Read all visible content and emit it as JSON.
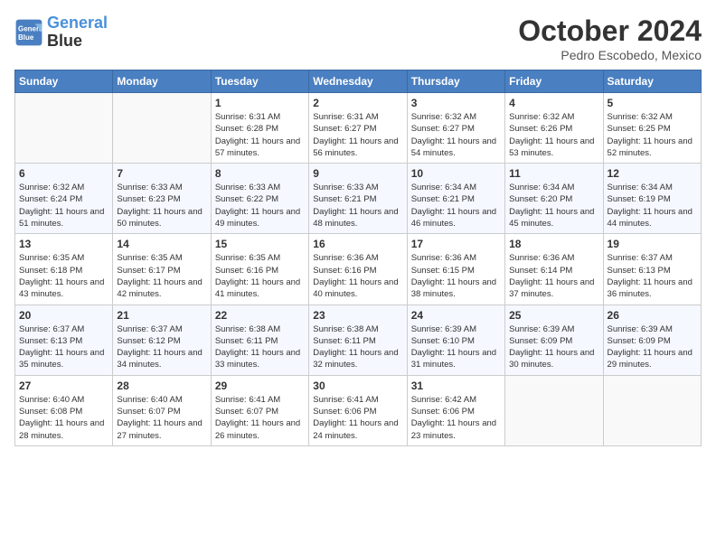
{
  "header": {
    "logo_line1": "General",
    "logo_line2": "Blue",
    "month_year": "October 2024",
    "location": "Pedro Escobedo, Mexico"
  },
  "weekdays": [
    "Sunday",
    "Monday",
    "Tuesday",
    "Wednesday",
    "Thursday",
    "Friday",
    "Saturday"
  ],
  "weeks": [
    [
      {
        "day": "",
        "info": ""
      },
      {
        "day": "",
        "info": ""
      },
      {
        "day": "1",
        "info": "Sunrise: 6:31 AM\nSunset: 6:28 PM\nDaylight: 11 hours and 57 minutes."
      },
      {
        "day": "2",
        "info": "Sunrise: 6:31 AM\nSunset: 6:27 PM\nDaylight: 11 hours and 56 minutes."
      },
      {
        "day": "3",
        "info": "Sunrise: 6:32 AM\nSunset: 6:27 PM\nDaylight: 11 hours and 54 minutes."
      },
      {
        "day": "4",
        "info": "Sunrise: 6:32 AM\nSunset: 6:26 PM\nDaylight: 11 hours and 53 minutes."
      },
      {
        "day": "5",
        "info": "Sunrise: 6:32 AM\nSunset: 6:25 PM\nDaylight: 11 hours and 52 minutes."
      }
    ],
    [
      {
        "day": "6",
        "info": "Sunrise: 6:32 AM\nSunset: 6:24 PM\nDaylight: 11 hours and 51 minutes."
      },
      {
        "day": "7",
        "info": "Sunrise: 6:33 AM\nSunset: 6:23 PM\nDaylight: 11 hours and 50 minutes."
      },
      {
        "day": "8",
        "info": "Sunrise: 6:33 AM\nSunset: 6:22 PM\nDaylight: 11 hours and 49 minutes."
      },
      {
        "day": "9",
        "info": "Sunrise: 6:33 AM\nSunset: 6:21 PM\nDaylight: 11 hours and 48 minutes."
      },
      {
        "day": "10",
        "info": "Sunrise: 6:34 AM\nSunset: 6:21 PM\nDaylight: 11 hours and 46 minutes."
      },
      {
        "day": "11",
        "info": "Sunrise: 6:34 AM\nSunset: 6:20 PM\nDaylight: 11 hours and 45 minutes."
      },
      {
        "day": "12",
        "info": "Sunrise: 6:34 AM\nSunset: 6:19 PM\nDaylight: 11 hours and 44 minutes."
      }
    ],
    [
      {
        "day": "13",
        "info": "Sunrise: 6:35 AM\nSunset: 6:18 PM\nDaylight: 11 hours and 43 minutes."
      },
      {
        "day": "14",
        "info": "Sunrise: 6:35 AM\nSunset: 6:17 PM\nDaylight: 11 hours and 42 minutes."
      },
      {
        "day": "15",
        "info": "Sunrise: 6:35 AM\nSunset: 6:16 PM\nDaylight: 11 hours and 41 minutes."
      },
      {
        "day": "16",
        "info": "Sunrise: 6:36 AM\nSunset: 6:16 PM\nDaylight: 11 hours and 40 minutes."
      },
      {
        "day": "17",
        "info": "Sunrise: 6:36 AM\nSunset: 6:15 PM\nDaylight: 11 hours and 38 minutes."
      },
      {
        "day": "18",
        "info": "Sunrise: 6:36 AM\nSunset: 6:14 PM\nDaylight: 11 hours and 37 minutes."
      },
      {
        "day": "19",
        "info": "Sunrise: 6:37 AM\nSunset: 6:13 PM\nDaylight: 11 hours and 36 minutes."
      }
    ],
    [
      {
        "day": "20",
        "info": "Sunrise: 6:37 AM\nSunset: 6:13 PM\nDaylight: 11 hours and 35 minutes."
      },
      {
        "day": "21",
        "info": "Sunrise: 6:37 AM\nSunset: 6:12 PM\nDaylight: 11 hours and 34 minutes."
      },
      {
        "day": "22",
        "info": "Sunrise: 6:38 AM\nSunset: 6:11 PM\nDaylight: 11 hours and 33 minutes."
      },
      {
        "day": "23",
        "info": "Sunrise: 6:38 AM\nSunset: 6:11 PM\nDaylight: 11 hours and 32 minutes."
      },
      {
        "day": "24",
        "info": "Sunrise: 6:39 AM\nSunset: 6:10 PM\nDaylight: 11 hours and 31 minutes."
      },
      {
        "day": "25",
        "info": "Sunrise: 6:39 AM\nSunset: 6:09 PM\nDaylight: 11 hours and 30 minutes."
      },
      {
        "day": "26",
        "info": "Sunrise: 6:39 AM\nSunset: 6:09 PM\nDaylight: 11 hours and 29 minutes."
      }
    ],
    [
      {
        "day": "27",
        "info": "Sunrise: 6:40 AM\nSunset: 6:08 PM\nDaylight: 11 hours and 28 minutes."
      },
      {
        "day": "28",
        "info": "Sunrise: 6:40 AM\nSunset: 6:07 PM\nDaylight: 11 hours and 27 minutes."
      },
      {
        "day": "29",
        "info": "Sunrise: 6:41 AM\nSunset: 6:07 PM\nDaylight: 11 hours and 26 minutes."
      },
      {
        "day": "30",
        "info": "Sunrise: 6:41 AM\nSunset: 6:06 PM\nDaylight: 11 hours and 24 minutes."
      },
      {
        "day": "31",
        "info": "Sunrise: 6:42 AM\nSunset: 6:06 PM\nDaylight: 11 hours and 23 minutes."
      },
      {
        "day": "",
        "info": ""
      },
      {
        "day": "",
        "info": ""
      }
    ]
  ]
}
